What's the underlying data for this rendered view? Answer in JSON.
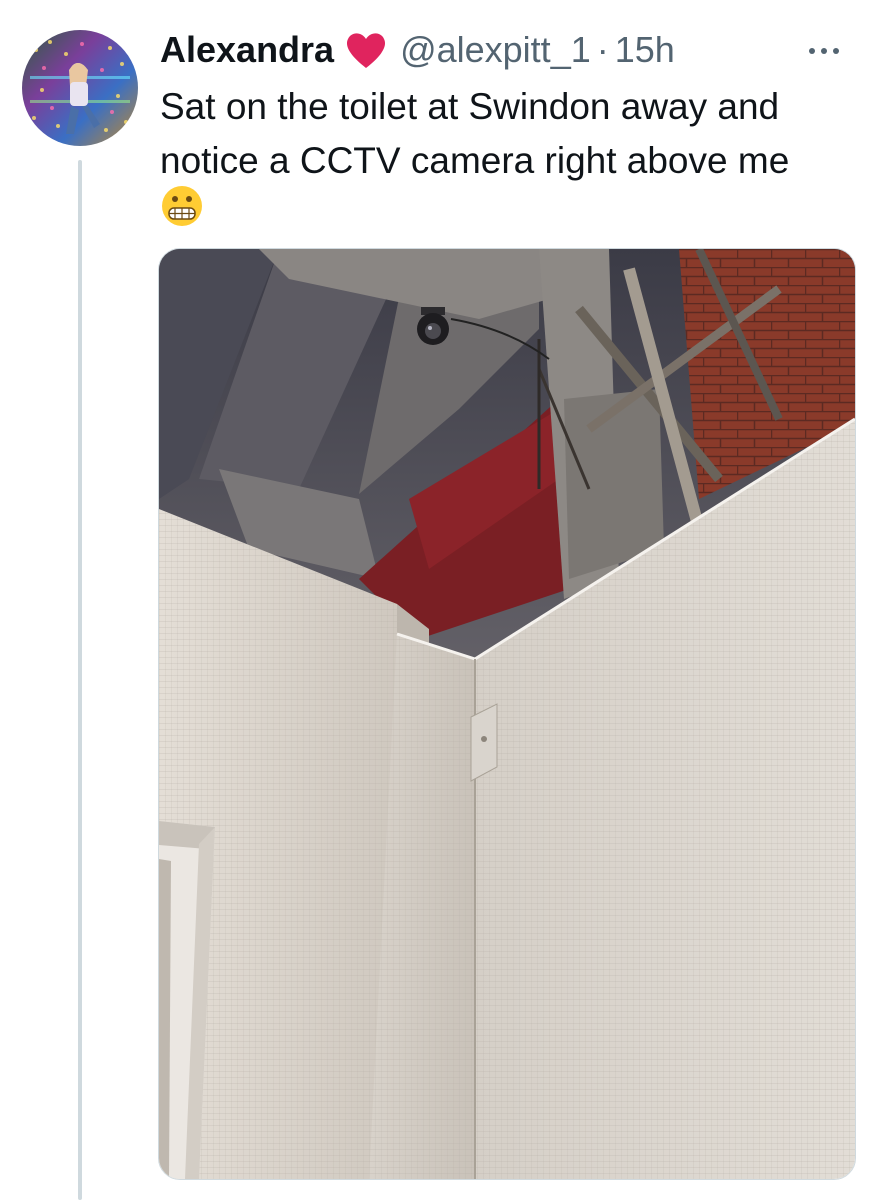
{
  "tweet": {
    "author": {
      "display_name": "Alexandra",
      "handle": "@alexpitt_1",
      "badge_icon": "heart-icon",
      "badge_color": "#e0245e"
    },
    "separator": "·",
    "timestamp": "15h",
    "text": "Sat on the toilet at Swindon away and notice a CCTV camera right above me",
    "emoji": "grimacing-face-emoji",
    "more_icon": "more-icon",
    "media_icon": "photo"
  },
  "colors": {
    "text_primary": "#0f1419",
    "text_secondary": "#536471",
    "thread_line": "#cfd9de"
  }
}
